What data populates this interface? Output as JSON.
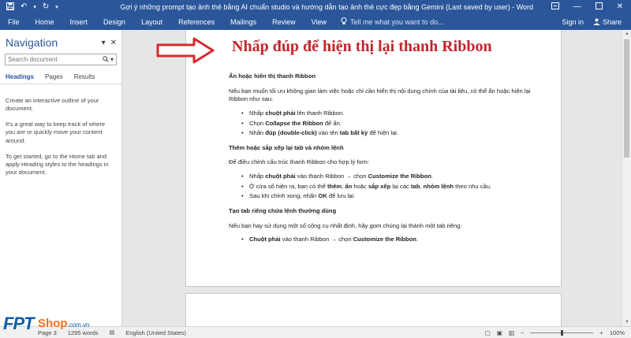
{
  "titlebar": {
    "title": "Gợi ý những prompt tạo ảnh thẻ bằng AI chuẩn studio và hướng dẫn tạo ảnh thẻ cực đẹp bằng Gemini (Last saved by user) - Word",
    "icons": [
      "save-icon",
      "undo-icon",
      "redo-icon",
      "customize-qat-icon",
      "ribbon-display-icon",
      "minimize-icon",
      "maximize-icon",
      "close-icon"
    ]
  },
  "ribbon": {
    "tabs": [
      "File",
      "Home",
      "Insert",
      "Design",
      "Layout",
      "References",
      "Mailings",
      "Review",
      "View"
    ],
    "tell_me": "Tell me what you want to do...",
    "sign_in": "Sign in",
    "share": "Share"
  },
  "navigation": {
    "title": "Navigation",
    "search_placeholder": "Search document",
    "tabs": [
      "Headings",
      "Pages",
      "Results"
    ],
    "paragraphs": [
      "Create an interactive outline of your document.",
      "It's a great way to keep track of where you are or quickly move your content around.",
      "To get started, go to the Home tab and apply Heading styles to the headings in your document."
    ]
  },
  "document": {
    "headline": "Nhấp đúp để hiện thị lại thanh Ribbon",
    "s1_heading": "Ẩn hoặc hiển thị thanh Ribbon",
    "s1_intro": "Nếu bạn muốn tối ưu không gian làm việc hoặc chỉ cần hiển thị nội dung chính của tài liệu, có thể ẩn hoặc hiện lại Ribbon như sau:",
    "s1_b1_pre": "Nhấp ",
    "s1_b1_bold": "chuột phải",
    "s1_b1_post": " lên thanh Ribbon.",
    "s1_b2_pre": "Chọn ",
    "s1_b2_bold": "Collapse the Ribbon",
    "s1_b2_post": " để ẩn.",
    "s1_b3_pre": "Nhấn ",
    "s1_b3_bold": "đúp (double-click)",
    "s1_b3_mid": " vào tên ",
    "s1_b3_bold2": "tab bất kỳ",
    "s1_b3_post": " để hiện lại.",
    "s2_heading": "Thêm hoặc sắp xếp lại tab và nhóm lệnh",
    "s2_intro": "Để điều chỉnh cấu trúc thanh Ribbon cho hợp lý hơn:",
    "s2_b1_pre": "Nhấp ",
    "s2_b1_bold": "chuột phải",
    "s2_b1_mid": " vào thanh Ribbon → chọn ",
    "s2_b1_bold2": "Customize the Ribbon",
    "s2_b1_post": ".",
    "s2_b2_pre": "Ở cửa sổ hiện ra, bạn có thể ",
    "s2_b2_bold": "thêm",
    "s2_b2_c1": ", ",
    "s2_b2_bold2": "ẩn",
    "s2_b2_mid": " hoặc ",
    "s2_b2_bold3": "sắp xếp",
    "s2_b2_mid2": " lại các ",
    "s2_b2_bold4": "tab",
    "s2_b2_c2": ", ",
    "s2_b2_bold5": "nhóm lệnh",
    "s2_b2_post": " theo nhu cầu.",
    "s2_b3_pre": "Sau khi chỉnh xong, nhấn ",
    "s2_b3_bold": "OK",
    "s2_b3_post": " để lưu lại.",
    "s3_heading": "Tạo tab riêng chứa lệnh thường dùng",
    "s3_intro": "Nếu bạn hay sử dụng một số công cụ nhất định, hãy gom chúng lại thành một tab riêng:",
    "s3_b1_bold": "Chuột phải",
    "s3_b1_mid": " vào thanh Ribbon → chọn ",
    "s3_b1_bold2": "Customize the Ribbon",
    "s3_b1_post": "."
  },
  "statusbar": {
    "page": "Page 3",
    "words": "1295 words",
    "language": "English (United States)",
    "zoom": "100%",
    "zoom_fraction": 0.5
  },
  "logo": {
    "brand": "FPT",
    "shop": "Shop",
    "domain": ".com.vn"
  },
  "colors": {
    "word_blue": "#2b579a",
    "headline_red": "#c0262c",
    "arrow_red": "#d42b2b"
  }
}
